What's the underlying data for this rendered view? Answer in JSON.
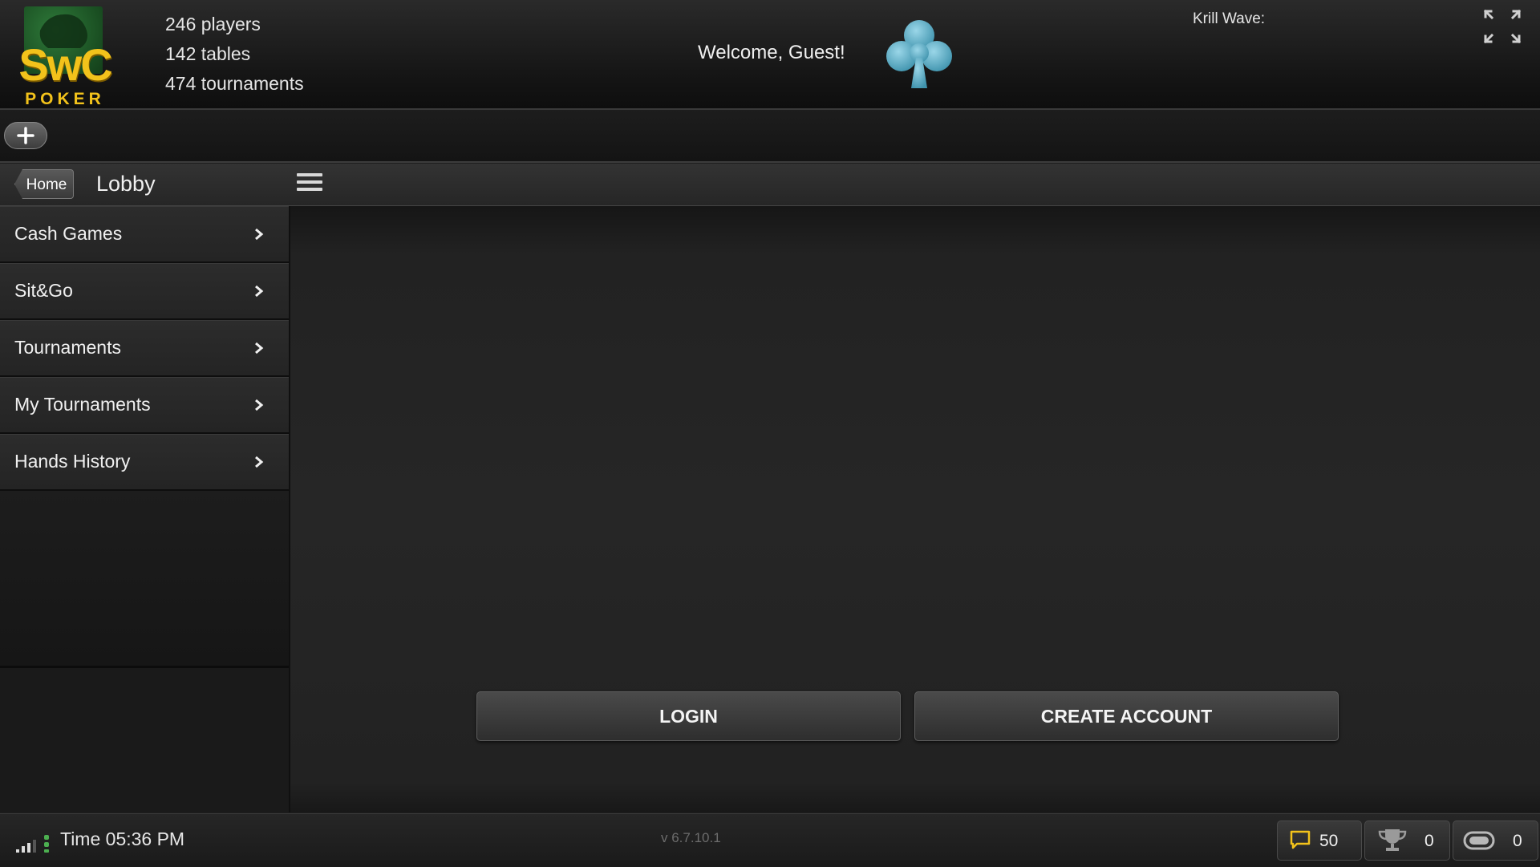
{
  "header": {
    "logo_main": "SwC",
    "logo_sub": "POKER",
    "stats": {
      "players": "246 players",
      "tables": "142 tables",
      "tournaments": "474 tournaments"
    },
    "welcome": "Welcome, Guest!",
    "krill_wave": "Krill Wave:"
  },
  "lobby": {
    "home_label": "Home",
    "title": "Lobby"
  },
  "sidebar": {
    "items": [
      {
        "label": "Cash Games"
      },
      {
        "label": "Sit&Go"
      },
      {
        "label": "Tournaments"
      },
      {
        "label": "My Tournaments"
      },
      {
        "label": "Hands History"
      }
    ]
  },
  "main": {
    "login_label": "LOGIN",
    "create_label": "CREATE ACCOUNT"
  },
  "footer": {
    "time": "Time 05:36 PM",
    "version": "v 6.7.10.1",
    "chat_count": "50",
    "trophy_count": "0",
    "tables_count": "0"
  },
  "colors": {
    "accent_club": "#5fb4cf",
    "logo_yellow": "#f2c21b",
    "logo_green": "#1a4f22",
    "chat_icon": "#f2c21b",
    "signal_green": "#4caf50"
  }
}
